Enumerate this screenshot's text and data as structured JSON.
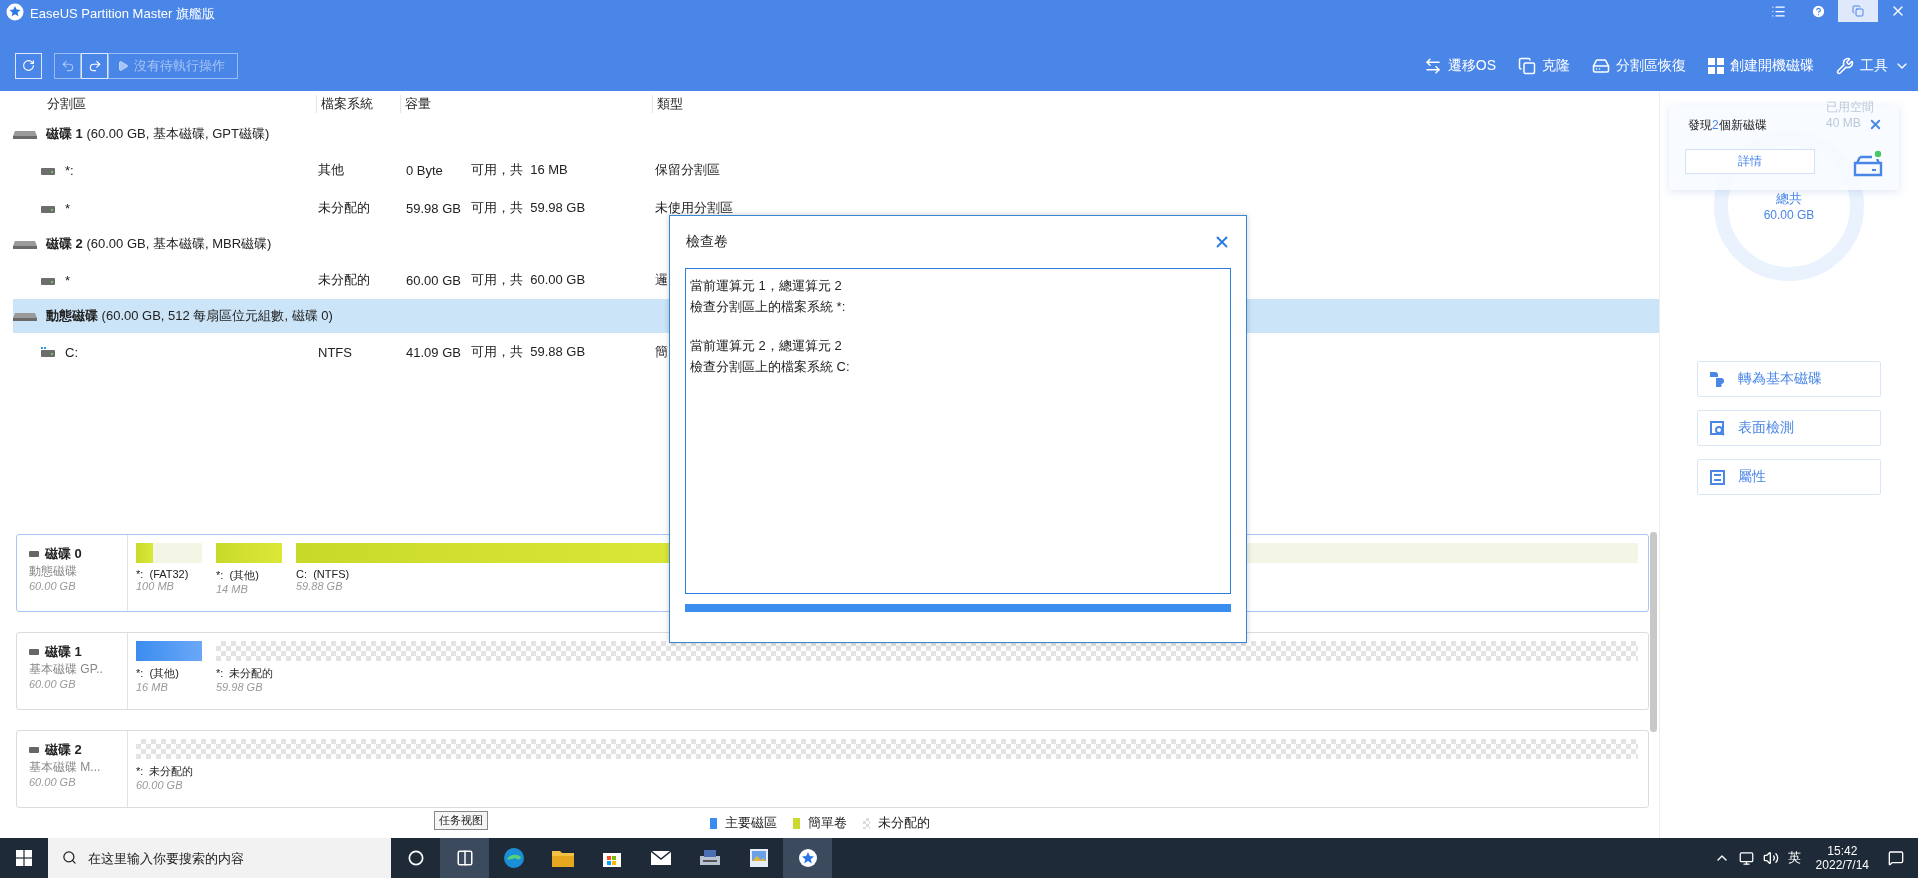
{
  "window": {
    "title": "EaseUS Partition Master 旗艦版"
  },
  "toolbar": {
    "undo_disabled": true,
    "redo_disabled": false,
    "pending": "沒有待執行操作",
    "pending_disabled": true,
    "actions": [
      {
        "label": "遷移OS",
        "kind": "migrate"
      },
      {
        "label": "克隆",
        "kind": "clone"
      },
      {
        "label": "分割區恢復",
        "kind": "recover"
      },
      {
        "label": "創建開機磁碟",
        "kind": "bootable"
      },
      {
        "label": "工具",
        "kind": "tools"
      }
    ]
  },
  "table": {
    "columns": [
      "分割區",
      "檔案系統",
      "容量",
      "類型"
    ],
    "rows": [
      {
        "kind": "disk",
        "name": "**磁碟 1** (60.00 GB, 基本磁碟, GPT磁碟)",
        "selected": false
      },
      {
        "kind": "partition",
        "name": "*:",
        "filesystem": "其他",
        "free": "0 Byte",
        "capacity": "可用，共  16 MB",
        "type": "保留分割區",
        "selected": false
      },
      {
        "kind": "partition",
        "name": "*",
        "filesystem": "未分配的",
        "free": "59.98 GB",
        "capacity": "可用，共  59.98 GB",
        "type": "未使用分割區",
        "selected": false
      },
      {
        "kind": "disk",
        "name": "**磁碟 2** (60.00 GB, 基本磁碟, MBR磁碟)",
        "selected": false
      },
      {
        "kind": "partition",
        "name": "*",
        "filesystem": "未分配的",
        "free": "60.00 GB",
        "capacity": "可用，共  60.00 GB",
        "type": "邏",
        "selected": false
      },
      {
        "kind": "disk",
        "name": "**動態磁碟** (60.00 GB, 512 每扇區位元組數, 磁碟 0)",
        "selected": true
      },
      {
        "kind": "system_partition",
        "name": "C:",
        "filesystem": "NTFS",
        "free": "41.09 GB",
        "capacity": "可用，共  59.88 GB",
        "type": "簡",
        "selected": false
      }
    ]
  },
  "disk_map": [
    {
      "name": "磁碟 0",
      "type": "動態磁碟",
      "size": "60.00 GB",
      "selected": true,
      "partitions": [
        {
          "name": "*:",
          "fs": "(FAT32)",
          "size": "100 MB",
          "kind": "simple",
          "wide": false,
          "level": 0.25
        },
        {
          "name": "*:",
          "fs": "(其他)",
          "size": "14 MB",
          "kind": "simple",
          "wide": false,
          "level": 1
        },
        {
          "name": "C:",
          "fs": "(NTFS)",
          "size": "59.88 GB",
          "kind": "simple",
          "wide": true,
          "level": 0.31
        }
      ]
    },
    {
      "name": "磁碟 1",
      "type": "基本磁碟 GP..",
      "size": "60.00 GB",
      "selected": false,
      "partitions": [
        {
          "name": "*:",
          "fs": "(其他)",
          "size": "16 MB",
          "kind": "primary",
          "wide": false,
          "level": 1
        },
        {
          "name": "*:",
          "fs": "未分配的",
          "size": "59.98 GB",
          "kind": "unallocated",
          "wide": true,
          "level": 1
        }
      ]
    },
    {
      "name": "磁碟 2",
      "type": "基本磁碟 M...",
      "size": "60.00 GB",
      "selected": false,
      "partitions": [
        {
          "name": "*:",
          "fs": "未分配的",
          "size": "60.00 GB",
          "kind": "unallocated",
          "wide": true,
          "level": 1
        }
      ]
    }
  ],
  "legend": [
    {
      "label": "主要磁區",
      "kind": "primary"
    },
    {
      "label": "簡單卷",
      "kind": "simple"
    },
    {
      "label": "未分配的",
      "kind": "unallocated"
    }
  ],
  "side_panel": {
    "notification": {
      "prefix": "發現",
      "count": "2",
      "suffix": "個新磁碟",
      "button": "詳情"
    },
    "usage": {
      "used_label": "已用空間",
      "used": "40 MB",
      "total_label": "總共",
      "total": "60.00 GB"
    },
    "actions": [
      {
        "label": "轉為基本磁碟",
        "kind": "convert"
      },
      {
        "label": "表面檢測",
        "kind": "surface"
      },
      {
        "label": "屬性",
        "kind": "properties"
      }
    ]
  },
  "dialog": {
    "title": "檢查卷",
    "log": [
      [
        "當前運算元 1，總運算元 2",
        "檢查分割區上的檔案系統 *:"
      ],
      [
        "當前運算元 2，總運算元 2",
        "檢查分割區上的檔案系統 C:"
      ]
    ],
    "progress": {
      "level": 1
    }
  },
  "taskbar": {
    "search_placeholder": "在这里输入你要搜索的内容",
    "tooltip": "任务视图",
    "apps": [
      {
        "kind": "cortana",
        "selected": false
      },
      {
        "kind": "taskview",
        "selected": true
      },
      {
        "kind": "edge",
        "selected": false
      },
      {
        "kind": "explorer",
        "selected": false
      },
      {
        "kind": "store",
        "selected": false
      },
      {
        "kind": "mail",
        "selected": false
      },
      {
        "kind": "scanner",
        "selected": false
      },
      {
        "kind": "viewer",
        "selected": false
      },
      {
        "kind": "easeus",
        "selected": true
      }
    ],
    "ime": "英",
    "time": "15:42",
    "date": "2022/7/14"
  }
}
